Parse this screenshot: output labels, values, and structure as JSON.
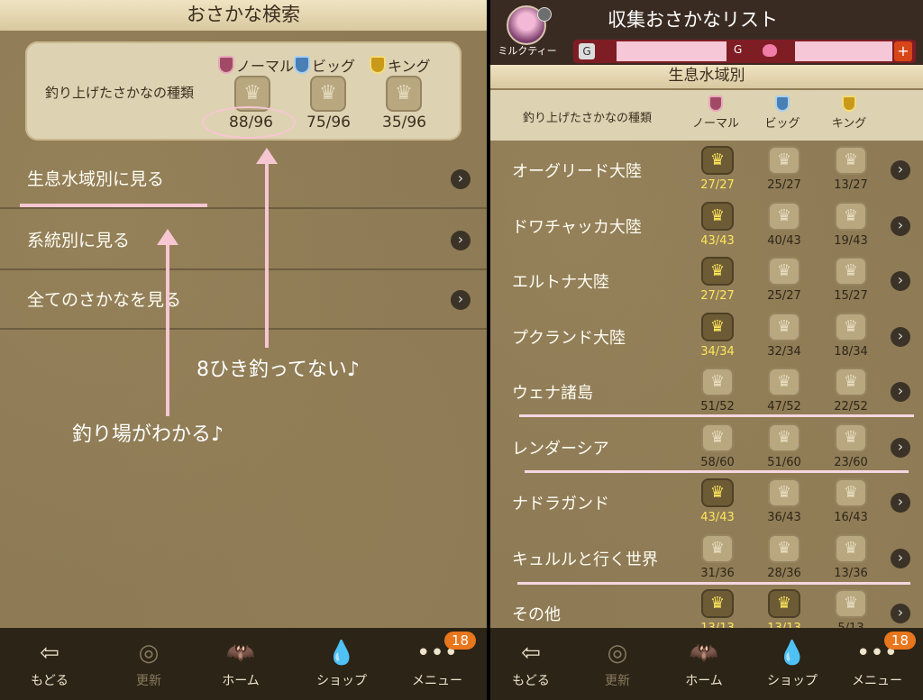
{
  "left": {
    "title": "おさかな検索",
    "summary_label": "釣り上げたさかなの種類",
    "ranks": [
      {
        "label": "ノーマル",
        "count": "88/96"
      },
      {
        "label": "ビッグ",
        "count": "75/96"
      },
      {
        "label": "キング",
        "count": "35/96"
      }
    ],
    "menu": [
      {
        "label": "生息水域別に見る"
      },
      {
        "label": "系統別に見る"
      },
      {
        "label": "全てのさかなを見る"
      }
    ],
    "notes": {
      "uncaught": "8ひき釣ってない♪",
      "spot": "釣り場がわかる♪"
    }
  },
  "right": {
    "title": "収集おさかなリスト",
    "player_name": "ミルクティー",
    "gold_symbol": "G",
    "plus": "+",
    "section": "生息水域別",
    "summary_label": "釣り上げたさかなの種類",
    "col_heads": [
      "ノーマル",
      "ビッグ",
      "キング"
    ],
    "rows": [
      {
        "label": "オーグリード大陸",
        "normal": "27/27",
        "big": "25/27",
        "king": "13/27"
      },
      {
        "label": "ドワチャッカ大陸",
        "normal": "43/43",
        "big": "40/43",
        "king": "19/43"
      },
      {
        "label": "エルトナ大陸",
        "normal": "27/27",
        "big": "25/27",
        "king": "15/27"
      },
      {
        "label": "プクランド大陸",
        "normal": "34/34",
        "big": "32/34",
        "king": "18/34"
      },
      {
        "label": "ウェナ諸島",
        "normal": "51/52",
        "big": "47/52",
        "king": "22/52"
      },
      {
        "label": "レンダーシア",
        "normal": "58/60",
        "big": "51/60",
        "king": "23/60"
      },
      {
        "label": "ナドラガンド",
        "normal": "43/43",
        "big": "36/43",
        "king": "16/43"
      },
      {
        "label": "キュルルと行く世界",
        "normal": "31/36",
        "big": "28/36",
        "king": "13/36"
      },
      {
        "label": "その他",
        "normal": "13/13",
        "big": "13/13",
        "king": "5/13"
      }
    ]
  },
  "footer": {
    "items": [
      {
        "label": "もどる",
        "icon": "back-arrow-icon"
      },
      {
        "label": "更新",
        "icon": "refresh-icon"
      },
      {
        "label": "ホーム",
        "icon": "dracky-home-icon"
      },
      {
        "label": "ショップ",
        "icon": "slime-shop-icon"
      },
      {
        "label": "メニュー",
        "icon": "menu-dots-icon"
      }
    ],
    "badge": "18"
  },
  "colors": {
    "panel": "#8e7b56",
    "header": "#efe3c2",
    "highlight": "#f6c7d2",
    "gold": "#ffe65c",
    "footer": "#2c2417"
  }
}
